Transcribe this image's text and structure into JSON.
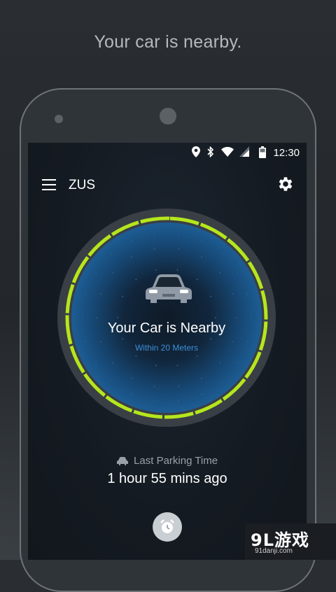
{
  "tagline": "Your car is nearby.",
  "status_bar": {
    "time": "12:30",
    "icons": [
      "location-icon",
      "bluetooth-icon",
      "wifi-icon",
      "signal-icon",
      "battery-icon"
    ]
  },
  "app_bar": {
    "title": "ZUS",
    "menu_icon": "menu-icon",
    "settings_icon": "gear-icon"
  },
  "dial": {
    "title": "Your Car is Nearby",
    "subtitle": "Within 20 Meters",
    "ring_color": "#b5e61d",
    "accent_color": "#3d8fd8",
    "icon": "car-icon"
  },
  "parking": {
    "label": "Last Parking Time",
    "value": "1 hour 55 mins ago",
    "icon": "car-icon"
  },
  "fab": {
    "icon": "alarm-clock-icon"
  },
  "watermark": {
    "logo": "9L游戏",
    "url": "91danji.com"
  }
}
